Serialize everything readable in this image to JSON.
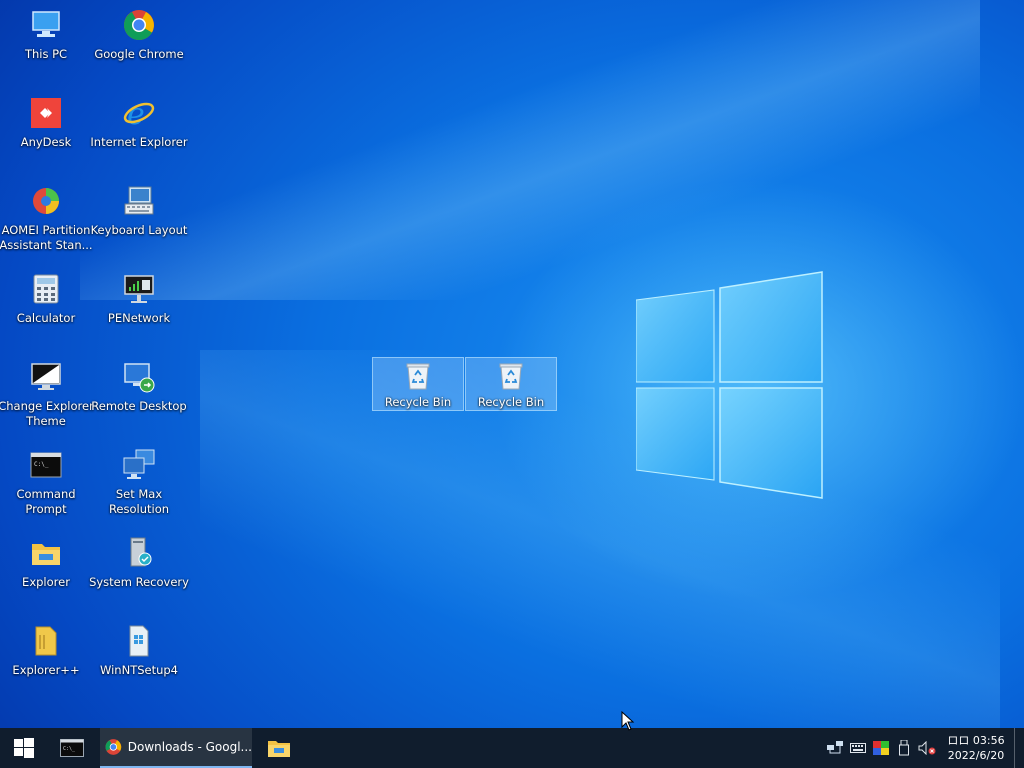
{
  "desktop_icons": [
    {
      "label": "This PC",
      "icon": "this-pc-icon"
    },
    {
      "label": "Google Chrome",
      "icon": "chrome-icon"
    },
    {
      "label": "AnyDesk",
      "icon": "anydesk-icon"
    },
    {
      "label": "Internet Explorer",
      "icon": "internet-explorer-icon"
    },
    {
      "label": "AOMEI Partition\nAssistant Stan...",
      "icon": "aomei-partition-icon"
    },
    {
      "label": "Keyboard Layout",
      "icon": "keyboard-layout-icon"
    },
    {
      "label": "Calculator",
      "icon": "calculator-icon"
    },
    {
      "label": "PENetwork",
      "icon": "penetwork-icon"
    },
    {
      "label": "Change Explorer\nTheme",
      "icon": "change-explorer-theme-icon"
    },
    {
      "label": "Remote Desktop",
      "icon": "remote-desktop-icon"
    },
    {
      "label": "Command\nPrompt",
      "icon": "command-prompt-icon"
    },
    {
      "label": "Set Max\nResolution",
      "icon": "set-max-resolution-icon"
    },
    {
      "label": "Explorer",
      "icon": "explorer-folder-icon"
    },
    {
      "label": "System Recovery",
      "icon": "system-recovery-icon"
    },
    {
      "label": "Explorer++",
      "icon": "explorer-plus-plus-icon"
    },
    {
      "label": "WinNTSetup4",
      "icon": "winntsetup-icon"
    }
  ],
  "selected_icons": [
    {
      "label": "Recycle Bin",
      "icon": "recycle-bin-icon"
    },
    {
      "label": "Recycle Bin",
      "icon": "recycle-bin-icon"
    }
  ],
  "taskbar": {
    "start_icon": "windows-start-icon",
    "tasks": [
      {
        "icon": "command-prompt-icon"
      },
      {
        "label": "Downloads - Googl...",
        "icon": "chrome-icon"
      },
      {
        "icon": "file-explorer-icon"
      }
    ],
    "tray_icons": [
      "network-icon",
      "keyboard-icon",
      "color-icon",
      "usb-icon",
      "volume-muted-icon"
    ],
    "clock": {
      "time": "ロロ 03:56",
      "date": "2022/6/20"
    }
  },
  "colors": {
    "taskbar_bg": "#101d2d",
    "desktop_accent": "#0a6fe0"
  }
}
